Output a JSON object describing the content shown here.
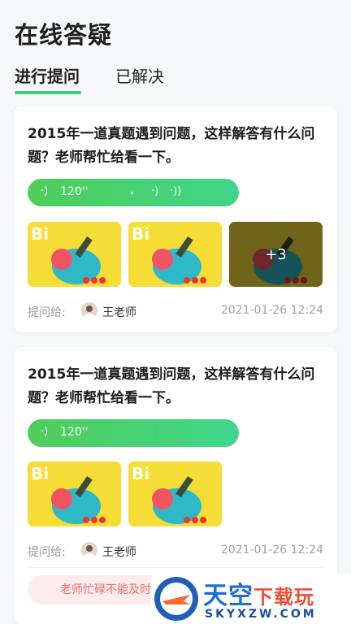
{
  "page": {
    "title": "在线答疑"
  },
  "tabs": [
    {
      "label": "进行提问",
      "active": true
    },
    {
      "label": "已解决",
      "active": false
    }
  ],
  "colors": {
    "accent": "#3dcf7c",
    "voice_start": "#4fce59",
    "voice_end": "#3fd58a",
    "busy_text": "#f0696a"
  },
  "questions": [
    {
      "text": "2015年一道真题遇到问题，这样解答有什么问题？老师帮忙给看一下。",
      "voice": {
        "duration": "120''"
      },
      "images": {
        "extra_count_label": "+3"
      },
      "meta": {
        "label": "提问给:",
        "teacher": "王老师",
        "time": "2021-01-26 12:24"
      }
    },
    {
      "text": "2015年一道真题遇到问题，这样解答有什么问题？老师帮忙给看一下。",
      "voice": {
        "duration": "120''"
      },
      "meta": {
        "label": "提问给:",
        "teacher": "王老师",
        "time": "2021-01-26 12:24"
      },
      "notice": "老师忙碌不能及时回复"
    }
  ],
  "watermark": {
    "main_a": "天空",
    "main_b": "下载玩",
    "sub": "SKYXZW.COM"
  }
}
